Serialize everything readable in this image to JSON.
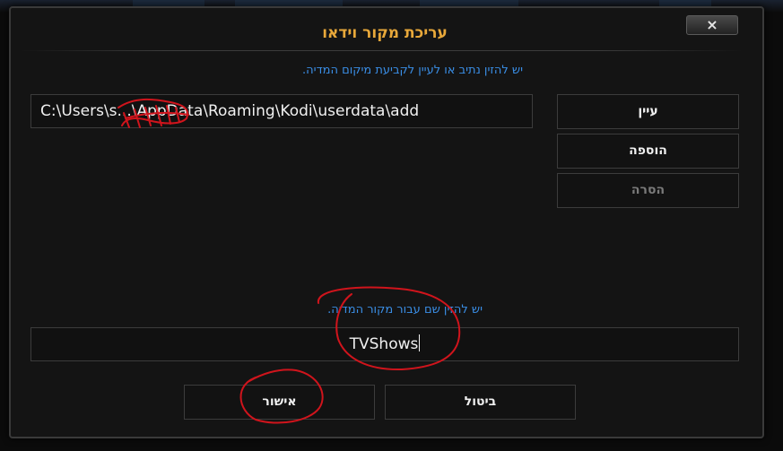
{
  "dialog": {
    "title": "עריכת מקור וידאו",
    "close_label": "×"
  },
  "path_section": {
    "hint": "יש להזין נתיב או לעיין לקביעת מיקום המדיה.",
    "value": "C:\\Users\\s...\\AppData\\Roaming\\Kodi\\userdata\\add"
  },
  "side_buttons": {
    "browse_label": "עיין",
    "add_label": "הוספה",
    "remove_label": "הסרה"
  },
  "name_section": {
    "hint": "יש להזין שם עבור מקור המדיה.",
    "value": "TVShows"
  },
  "bottom_buttons": {
    "ok_label": "אישור",
    "cancel_label": "ביטול"
  },
  "colors": {
    "title": "#e8a83a",
    "hint": "#3a8ee6",
    "annotation": "#d0141c",
    "disabled_text": "#7a7a7a"
  }
}
